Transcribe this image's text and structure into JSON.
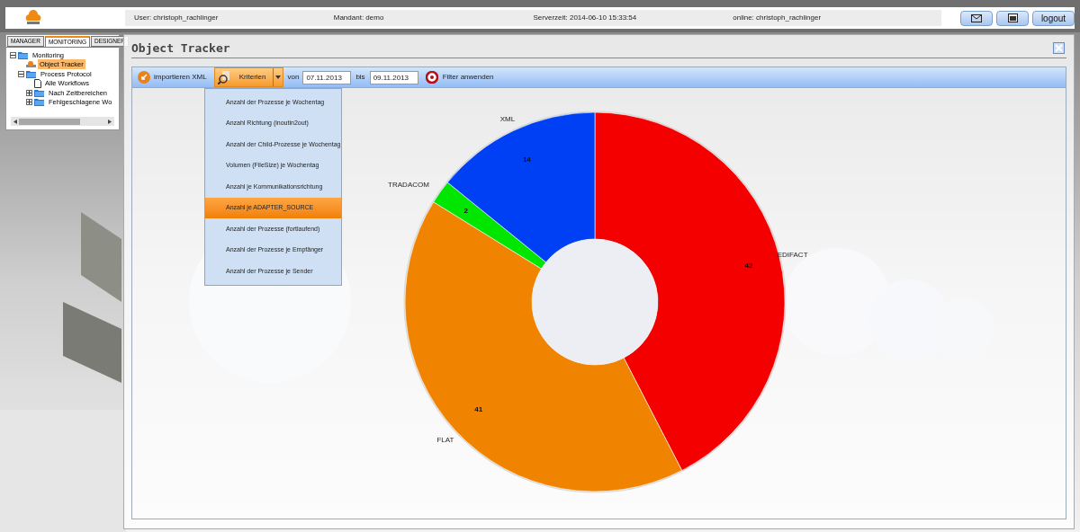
{
  "header": {
    "fields": [
      "User: christoph_rachlinger",
      "Mandant: demo",
      "Serverzeit: 2014-06-10 15:33:54",
      "online: christoph_rachlinger"
    ],
    "buttons": [
      {
        "kind": "mail"
      },
      {
        "kind": "calendar"
      },
      {
        "kind": "text",
        "label": "logout"
      }
    ]
  },
  "sidebar": {
    "tabs": [
      {
        "label": "MANAGER",
        "selected": false
      },
      {
        "label": "MONITORING",
        "selected": true
      },
      {
        "label": "DESIGNER",
        "selected": false
      }
    ],
    "tree": [
      {
        "label": "Monitoring",
        "kind": "folder",
        "expanded": true,
        "selected": false,
        "children": [
          {
            "label": "Object Tracker",
            "kind": "tracker",
            "selected": true
          },
          {
            "label": "Process Protocol",
            "kind": "folder",
            "expanded": true,
            "selected": false,
            "children": [
              {
                "label": "Alle Workflows",
                "kind": "document",
                "selected": false
              },
              {
                "label": "Nach Zeitbereichen",
                "kind": "folder",
                "expanded": false,
                "selected": false
              },
              {
                "label": "Fehlgeschlagene Wo",
                "kind": "folder",
                "expanded": false,
                "selected": false
              }
            ]
          }
        ]
      }
    ]
  },
  "panel": {
    "title": "Object Tracker",
    "toolbar": {
      "import_label": "importieren XML",
      "criteria_label": "Kriterien",
      "criteria_open": true,
      "from_label": "von",
      "from_value": "07.11.2013",
      "to_label": "bis",
      "to_value": "09.11.2013",
      "filter_label": "Filter anwenden"
    },
    "menu": [
      {
        "label": "Anzahl der Prozesse je Wochentag",
        "selected": false
      },
      {
        "label": "Anzahl Richtung (inoutin2out)",
        "selected": false
      },
      {
        "label": "Anzahl der Child-Prozesse je Wochentag",
        "selected": false
      },
      {
        "label": "Volumen (FileSize) je Wochentag",
        "selected": false
      },
      {
        "label": "Anzahl je Kommunikationsrichtung",
        "selected": false
      },
      {
        "label": "Anzahl je ADAPTER_SOURCE",
        "selected": true
      },
      {
        "label": "Anzahl der Prozesse (fortlaufend)",
        "selected": false
      },
      {
        "label": "Anzahl der Prozesse je Empfänger",
        "selected": false
      },
      {
        "label": "Anzahl der Prozesse je Sender",
        "selected": false
      }
    ],
    "chart_data": {
      "type": "donut",
      "categories": [
        "EDIFACT",
        "FLAT",
        "TRADACOM",
        "XML"
      ],
      "data_labels": true,
      "series": [
        {
          "colors": [
            "#f50000",
            "#f08400",
            "#00e600",
            "#0040f5"
          ],
          "values": [
            42,
            41,
            2,
            14
          ]
        }
      ]
    }
  }
}
